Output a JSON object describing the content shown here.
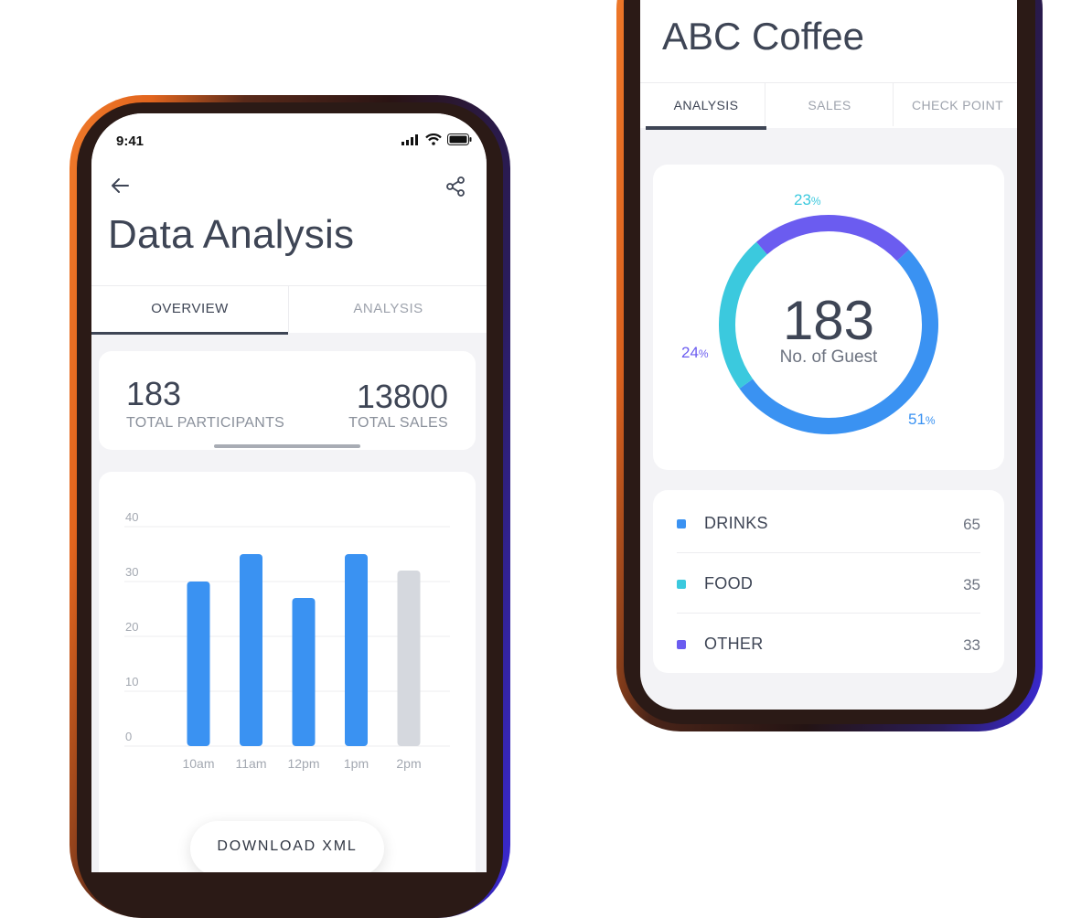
{
  "left_phone": {
    "status": {
      "time": "9:41"
    },
    "title": "Data Analysis",
    "tabs": [
      {
        "label": "OVERVIEW"
      },
      {
        "label": "ANALYSIS"
      }
    ],
    "stats": {
      "participants_value": "183",
      "participants_label": "TOTAL PARTICIPANTS",
      "sales_value": "13800",
      "sales_label": "TOTAL SALES"
    },
    "download_label": "DOWNLOAD XML"
  },
  "right_phone": {
    "title": "ABC Coffee",
    "tabs": [
      {
        "label": "ANALYSIS"
      },
      {
        "label": "SALES"
      },
      {
        "label": "CHECK POINT"
      }
    ],
    "donut": {
      "center_value": "183",
      "center_label": "No. of Guest",
      "segments": [
        {
          "value": "51",
          "color": "#3a92f2"
        },
        {
          "value": "23",
          "color": "#3bc9de"
        },
        {
          "value": "24",
          "color": "#6b5cf0"
        }
      ],
      "pct_suffix": "%"
    },
    "legend": [
      {
        "label": "DRINKS",
        "value": "65",
        "color": "#3a92f2"
      },
      {
        "label": "FOOD",
        "value": "35",
        "color": "#3bc9de"
      },
      {
        "label": "OTHER",
        "value": "33",
        "color": "#6b5cf0"
      }
    ]
  },
  "chart_data": [
    {
      "type": "bar",
      "categories": [
        "10am",
        "11am",
        "12pm",
        "1pm",
        "2pm"
      ],
      "values": [
        30,
        35,
        27,
        35,
        32
      ],
      "ylim": [
        0,
        40
      ],
      "yticks": [
        "0",
        "10",
        "20",
        "30",
        "40"
      ],
      "grid": true,
      "colors": [
        "#3a92f2",
        "#3a92f2",
        "#3a92f2",
        "#3a92f2",
        "#d5d8de"
      ]
    },
    {
      "type": "pie",
      "categories": [
        "51%",
        "23%",
        "24%"
      ],
      "values": [
        51,
        23,
        24
      ],
      "colors": [
        "#3a92f2",
        "#3bc9de",
        "#6b5cf0"
      ]
    }
  ]
}
